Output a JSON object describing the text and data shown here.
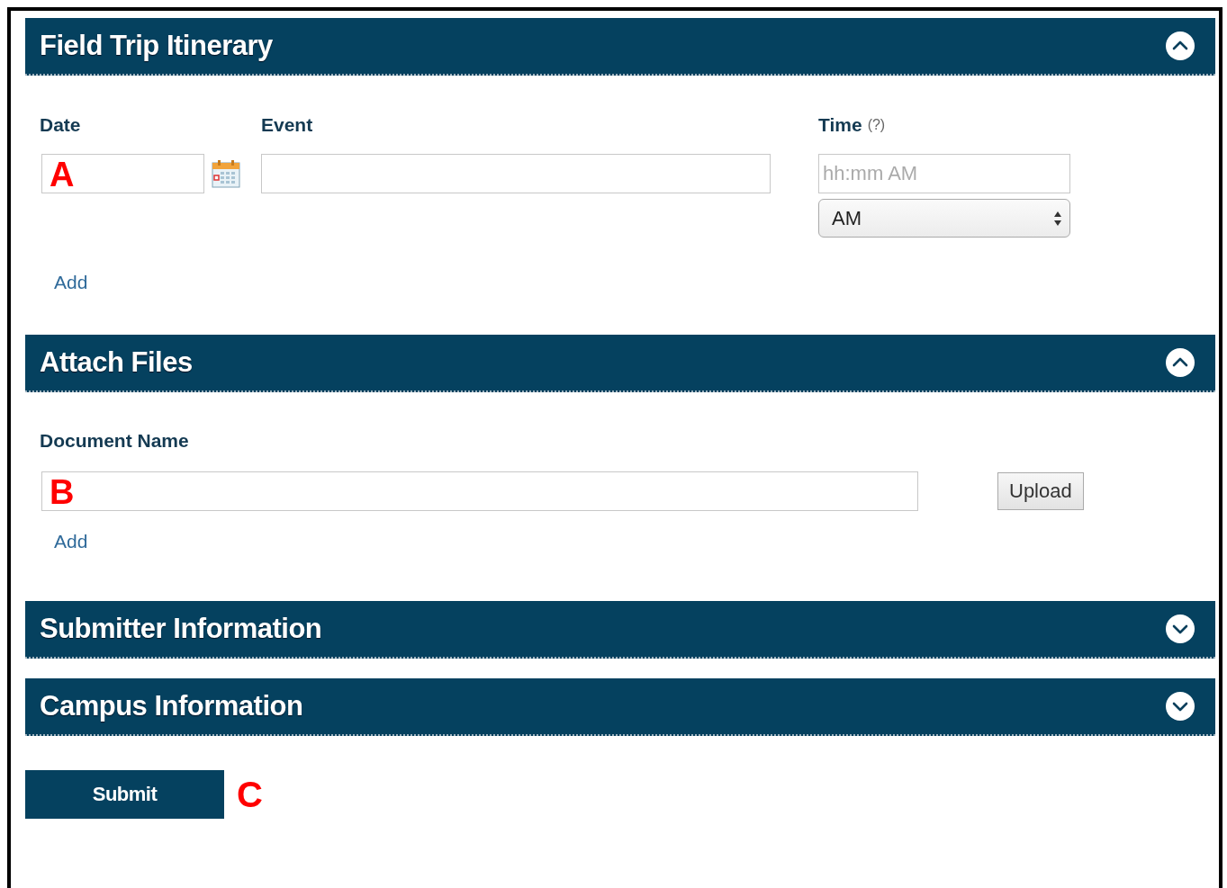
{
  "sections": [
    {
      "kind": "itinerary",
      "title": "Field Trip Itinerary",
      "expanded": true,
      "date_label": "Date",
      "date_callout": "A",
      "event_label": "Event",
      "time_label": "Time",
      "time_help": "(?)",
      "time_placeholder": "hh:mm AM",
      "meridiem": "AM",
      "add_link": "Add"
    },
    {
      "kind": "files",
      "title": "Attach Files",
      "expanded": true,
      "document_label": "Document Name",
      "document_callout": "B",
      "upload_button": "Upload",
      "add_link": "Add"
    },
    {
      "kind": "collapsed",
      "title": "Submitter Information",
      "expanded": false
    },
    {
      "kind": "collapsed",
      "title": "Campus Information",
      "expanded": false
    }
  ],
  "submit": {
    "label": "Submit",
    "callout": "C"
  }
}
